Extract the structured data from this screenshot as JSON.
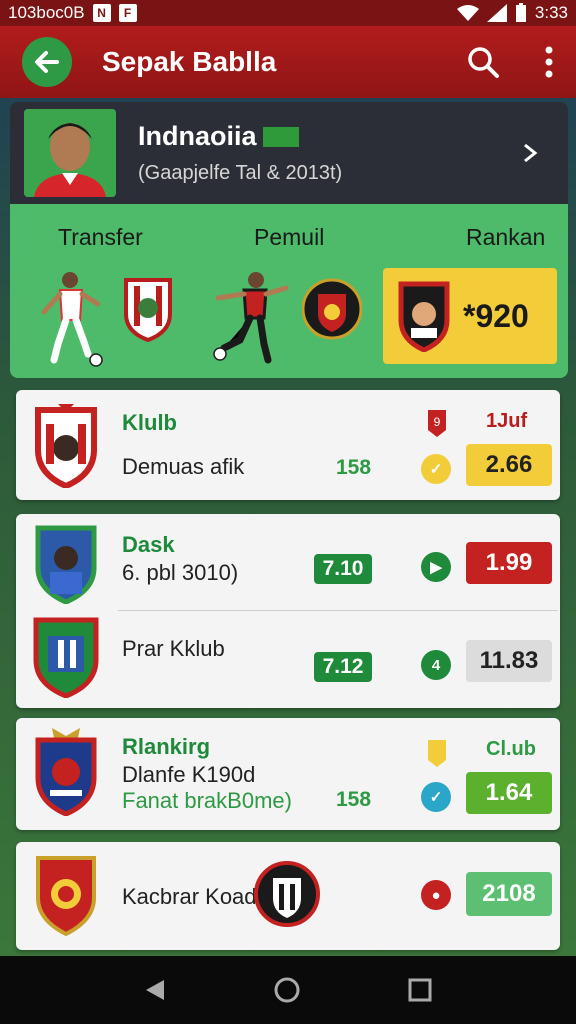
{
  "status": {
    "left": "103boc0B",
    "time": "3:33"
  },
  "appbar": {
    "title": "Sepak Bablla"
  },
  "profile": {
    "name": "Indnaoiia",
    "subtitle": "(Gaapjelfe Tal & 2013t)"
  },
  "tabs": [
    {
      "label": "Transfer"
    },
    {
      "label": "Pemuil"
    },
    {
      "label": "Rankan"
    }
  ],
  "rank": {
    "value": "*920"
  },
  "cards": [
    {
      "title": "Klulb",
      "tag": "1Juf",
      "subtitle": "Demuas afik",
      "count": "158",
      "value": "2.66"
    },
    {
      "title": "Dask",
      "subtitle": "6. pbl 3010)",
      "badge": "7.10",
      "value": "1.99"
    },
    {
      "title": "Prar Kklub",
      "badge": "7.12",
      "value": "11.83"
    },
    {
      "title": "Rlankirg",
      "tag": "Cl.ub",
      "line2": "Dlanfe K190d",
      "line3": "Fanat brakB0me)",
      "count": "158",
      "value": "1.64"
    },
    {
      "title": "Kacbrar Koad",
      "value": "2108"
    }
  ],
  "colors": {
    "red": "#b21c1c",
    "green": "#2e9a44",
    "yellow": "#f3cc3a",
    "grey": "#dcdcdc"
  }
}
